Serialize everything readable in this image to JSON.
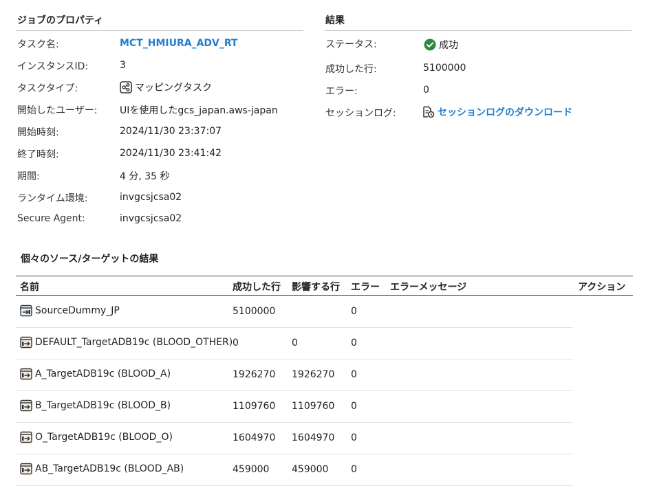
{
  "job_properties": {
    "title": "ジョブのプロパティ",
    "rows": [
      {
        "label": "タスク名:",
        "value": "MCT_HMIURA_ADV_RT"
      },
      {
        "label": "インスタンスID:",
        "value": "3"
      },
      {
        "label": "タスクタイプ:",
        "value": "マッピングタスク"
      },
      {
        "label": "開始したユーザー:",
        "value": "UIを使用したgcs_japan.aws-japan"
      },
      {
        "label": "開始時刻:",
        "value": "2024/11/30 23:37:07"
      },
      {
        "label": "終了時刻:",
        "value": "2024/11/30 23:41:42"
      },
      {
        "label": "期間:",
        "value": "4 分, 35 秒"
      },
      {
        "label": "ランタイム環境:",
        "value": "invgcsjcsa02"
      },
      {
        "label": "Secure Agent:",
        "value": "invgcsjcsa02"
      }
    ]
  },
  "results": {
    "title": "結果",
    "rows": [
      {
        "label": "ステータス:",
        "value": "成功"
      },
      {
        "label": "成功した行:",
        "value": "5100000"
      },
      {
        "label": "エラー:",
        "value": "0"
      },
      {
        "label": "セッションログ:",
        "value": "セッションログのダウンロード"
      }
    ]
  },
  "individual": {
    "title": "個々のソース/ターゲットの結果",
    "headers": {
      "name": "名前",
      "success_rows": "成功した行",
      "affected_rows": "影響する行",
      "errors": "エラー",
      "error_message": "エラーメッセージ",
      "action": "アクション"
    },
    "rows": [
      {
        "name": "SourceDummy_JP",
        "success": "5100000",
        "affected": "",
        "errors": "0",
        "kind": "source"
      },
      {
        "name": "DEFAULT_TargetADB19c (BLOOD_OTHER)",
        "success": "0",
        "affected": "0",
        "errors": "0",
        "kind": "target"
      },
      {
        "name": "A_TargetADB19c (BLOOD_A)",
        "success": "1926270",
        "affected": "1926270",
        "errors": "0",
        "kind": "target"
      },
      {
        "name": "B_TargetADB19c (BLOOD_B)",
        "success": "1109760",
        "affected": "1109760",
        "errors": "0",
        "kind": "target"
      },
      {
        "name": "O_TargetADB19c (BLOOD_O)",
        "success": "1604970",
        "affected": "1604970",
        "errors": "0",
        "kind": "target"
      },
      {
        "name": "AB_TargetADB19c (BLOOD_AB)",
        "success": "459000",
        "affected": "459000",
        "errors": "0",
        "kind": "target"
      }
    ]
  },
  "colors": {
    "link": "#1f7fd1",
    "success": "#2e8b3e"
  },
  "icons": {
    "task_type": "mapping-task-icon",
    "status": "check-circle-icon",
    "session_log": "log-download-icon",
    "source": "source-icon",
    "target": "target-icon"
  }
}
